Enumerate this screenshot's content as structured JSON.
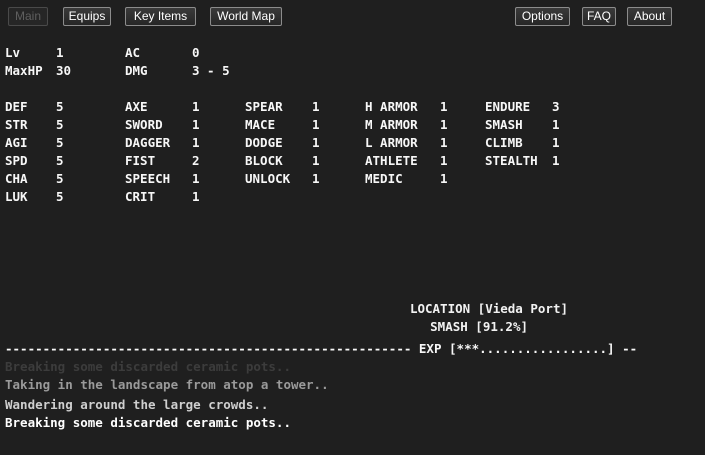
{
  "nav": {
    "main": "Main",
    "equips": "Equips",
    "key_items": "Key Items",
    "world_map": "World Map",
    "options": "Options",
    "faq": "FAQ",
    "about": "About"
  },
  "summary": {
    "lv_label": "Lv",
    "lv_value": "1",
    "ac_label": "AC",
    "ac_value": "0",
    "maxhp_label": "MaxHP",
    "maxhp_value": "30",
    "dmg_label": "DMG",
    "dmg_value": "3 - 5"
  },
  "stats": [
    [
      [
        "DEF",
        "5"
      ],
      [
        "AXE",
        "1"
      ],
      [
        "SPEAR",
        "1"
      ],
      [
        "H ARMOR",
        "1"
      ],
      [
        "ENDURE",
        "3"
      ]
    ],
    [
      [
        "STR",
        "5"
      ],
      [
        "SWORD",
        "1"
      ],
      [
        "MACE",
        "1"
      ],
      [
        "M ARMOR",
        "1"
      ],
      [
        "SMASH",
        "1"
      ]
    ],
    [
      [
        "AGI",
        "5"
      ],
      [
        "DAGGER",
        "1"
      ],
      [
        "DODGE",
        "1"
      ],
      [
        "L ARMOR",
        "1"
      ],
      [
        "CLIMB",
        "1"
      ]
    ],
    [
      [
        "SPD",
        "5"
      ],
      [
        "FIST",
        "2"
      ],
      [
        "BLOCK",
        "1"
      ],
      [
        "ATHLETE",
        "1"
      ],
      [
        "STEALTH",
        "1"
      ]
    ],
    [
      [
        "CHA",
        "5"
      ],
      [
        "SPEECH",
        "1"
      ],
      [
        "UNLOCK",
        "1"
      ],
      [
        "MEDIC",
        "1"
      ]
    ],
    [
      [
        "LUK",
        "5"
      ],
      [
        "CRIT",
        "1"
      ]
    ]
  ],
  "status": {
    "location": "LOCATION [Vieda Port]",
    "activity": "SMASH [91.2%]",
    "exp_bar": "------------------------------------------------------ EXP [***.................] --"
  },
  "log": [
    "Breaking some discarded ceramic pots..",
    "Taking in the landscape from atop a tower..",
    "Wandering around the large crowds..",
    "Breaking some discarded ceramic pots.."
  ],
  "colors": {
    "background": "#1f1f1f",
    "text": "#f7f7f7",
    "log_faint": "#3c3c3c",
    "log_dim": "#9a9a9a",
    "log_mid": "#cfcfcf",
    "log_bright": "#ffffff"
  }
}
